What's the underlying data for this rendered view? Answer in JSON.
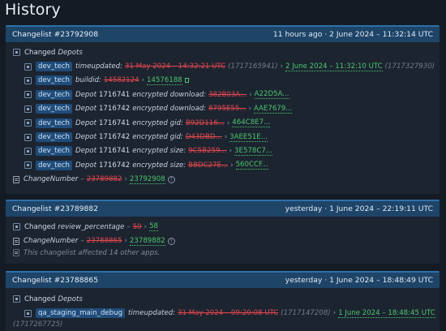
{
  "page": {
    "title": "History"
  },
  "cards": [
    {
      "title": "Changelist #23792908",
      "date": "11 hours ago · 2 June 2024 – 11:32:14 UTC",
      "section_label": "Changed",
      "section_target": "Depots",
      "rows": [
        {
          "tag": "dev_tech",
          "field": "timeupdated:",
          "old": "31 May 2024 – 14:32:21 UTC",
          "old_extra": "(1717165941)",
          "new": "2 June 2024 – 11:32:10 UTC",
          "new_extra": "(1717327930)"
        },
        {
          "tag": "dev_tech",
          "field": "buildid:",
          "old": "14582124",
          "new": "14576188"
        },
        {
          "tag": "dev_tech",
          "depot_label": "Depot",
          "depot_id": "1716741",
          "field": "encrypted download:",
          "old": "382B03A...",
          "new": "A22D5A..."
        },
        {
          "tag": "dev_tech",
          "depot_label": "Depot",
          "depot_id": "1716742",
          "field": "encrypted download:",
          "old": "8795E55...",
          "new": "AAE7679..."
        },
        {
          "tag": "dev_tech",
          "depot_label": "Depot",
          "depot_id": "1716741",
          "field": "encrypted gid:",
          "old": "B92D116...",
          "new": "464C8E7..."
        },
        {
          "tag": "dev_tech",
          "depot_label": "Depot",
          "depot_id": "1716742",
          "field": "encrypted gid:",
          "old": "D43DBD...",
          "new": "3AEE51E..."
        },
        {
          "tag": "dev_tech",
          "depot_label": "Depot",
          "depot_id": "1716741",
          "field": "encrypted size:",
          "old": "9C5B259...",
          "new": "3E578C7..."
        },
        {
          "tag": "dev_tech",
          "depot_label": "Depot",
          "depot_id": "1716742",
          "field": "encrypted size:",
          "old": "BBDC27E...",
          "new": "560CCF..."
        }
      ],
      "change_number": {
        "label": "ChangeNumber",
        "old": "23789882",
        "new": "23792908"
      }
    },
    {
      "title": "Changelist #23789882",
      "date": "yesterday · 1 June 2024 – 22:19:11 UTC",
      "changed_row": {
        "label": "Changed",
        "field": "review_percentage",
        "old": "59",
        "new": "58"
      },
      "change_number": {
        "label": "ChangeNumber",
        "old": "23788865",
        "new": "23789882"
      },
      "note": "This changelist affected 14 other apps."
    },
    {
      "title": "Changelist #23788865",
      "date": "yesterday · 1 June 2024 – 18:48:49 UTC",
      "section_label": "Changed",
      "section_target": "Depots",
      "row": {
        "tag": "qa_staging_main_debug",
        "field": "timeupdated:",
        "old": "31 May 2024 – 09:20:08 UTC",
        "old_extra": "(1717147208)",
        "new": "1 June 2024 – 18:48:45 UTC",
        "new_extra": "(1717267725)"
      }
    }
  ]
}
